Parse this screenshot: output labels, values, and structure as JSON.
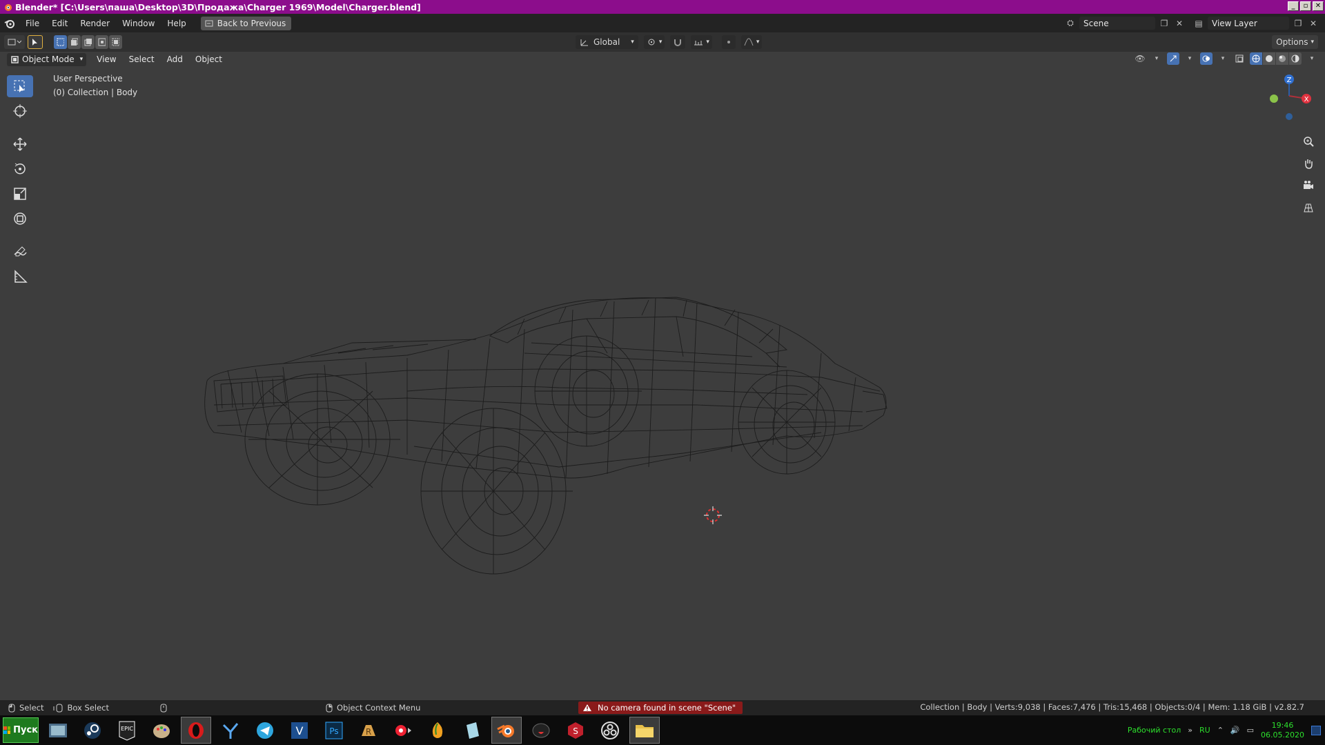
{
  "titlebar": {
    "title": "Blender* [C:\\Users\\паша\\Desktop\\3D\\Продажа\\Charger 1969\\Model\\Charger.blend]",
    "bg_color": "#8c0d8c"
  },
  "menubar": {
    "items": [
      "File",
      "Edit",
      "Render",
      "Window",
      "Help"
    ],
    "back_button": "Back to Previous",
    "scene_name": "Scene",
    "view_layer": "View Layer"
  },
  "toolbar": {
    "transform_orientation": "Global",
    "options_label": "Options"
  },
  "header": {
    "mode": "Object Mode",
    "menus": [
      "View",
      "Select",
      "Add",
      "Object"
    ]
  },
  "viewport": {
    "perspective_label": "User Perspective",
    "collection_label": "(0) Collection | Body",
    "gizmo_axes": {
      "z": "Z",
      "x": "X"
    },
    "accent_color": "#4772b3"
  },
  "statusbar": {
    "select_label": "Select",
    "box_select_label": "Box Select",
    "context_menu_label": "Object Context Menu",
    "warning_text": "No camera found in scene \"Scene\"",
    "stats": "Collection | Body | Verts:9,038 | Faces:7,476 | Tris:15,468 | Objects:0/4 | Mem: 1.18 GiB | v2.82.7"
  },
  "taskbar": {
    "start_label": "Пуск",
    "desktop_label": "Рабочий стол",
    "language": "RU",
    "time": "19:46",
    "date": "06.05.2020",
    "icons": [
      "file-manager-icon",
      "steam-icon",
      "epic-games-icon",
      "paint-icon",
      "opera-icon",
      "yandex-icon",
      "telegram-icon",
      "vegas-icon",
      "photoshop-icon",
      "rhino-icon",
      "media-icon",
      "fl-studio-icon",
      "notepad-icon",
      "blender-icon",
      "app-icon",
      "substance-icon",
      "obs-icon",
      "folder-icon"
    ]
  }
}
